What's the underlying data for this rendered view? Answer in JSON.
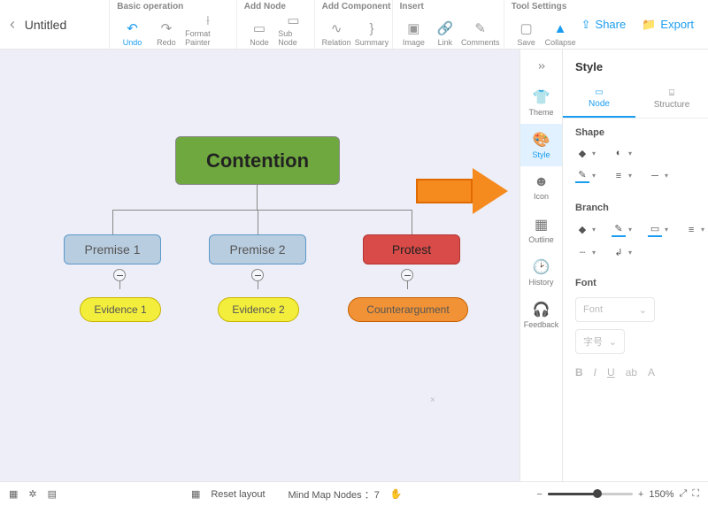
{
  "header": {
    "title": "Untitled",
    "groups": {
      "basic": {
        "label": "Basic operation",
        "undo": "Undo",
        "redo": "Redo",
        "formatPainter": "Format Painter"
      },
      "addNode": {
        "label": "Add Node",
        "node": "Node",
        "subNode": "Sub Node"
      },
      "addComponent": {
        "label": "Add Component",
        "relation": "Relation",
        "summary": "Summary"
      },
      "insert": {
        "label": "Insert",
        "image": "Image",
        "link": "Link",
        "comments": "Comments"
      },
      "toolSettings": {
        "label": "Tool Settings",
        "save": "Save",
        "collapse": "Collapse"
      }
    },
    "share": "Share",
    "export": "Export"
  },
  "mindmap": {
    "root": "Contention",
    "premise1": "Premise 1",
    "premise2": "Premise 2",
    "protest": "Protest",
    "evidence1": "Evidence 1",
    "evidence2": "Evidence 2",
    "counter": "Counterargument"
  },
  "rail": {
    "theme": "Theme",
    "style": "Style",
    "icon": "Icon",
    "outline": "Outline",
    "history": "History",
    "feedback": "Feedback"
  },
  "panel": {
    "title": "Style",
    "tabNode": "Node",
    "tabStructure": "Structure",
    "shape": "Shape",
    "branch": "Branch",
    "font": "Font",
    "fontPlaceholder": "Font",
    "widthPlaceholder": "字号"
  },
  "bottom": {
    "reset": "Reset layout",
    "nodesLabel": "Mind Map Nodes",
    "nodesCount": "7",
    "zoom": "150%"
  }
}
